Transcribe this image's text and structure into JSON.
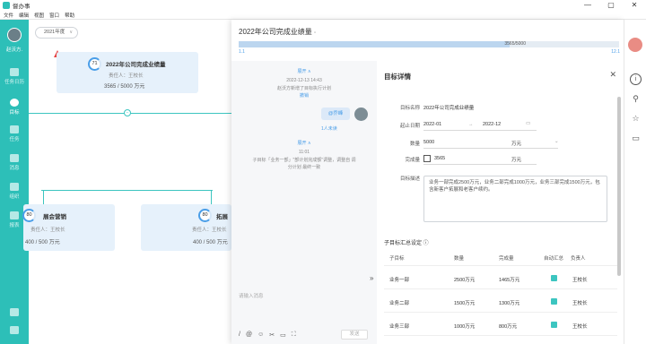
{
  "window": {
    "app_name": "督办事",
    "menu": [
      "文件",
      "编辑",
      "视图",
      "窗口",
      "帮助"
    ],
    "controls": [
      "—",
      "▢",
      "✕"
    ]
  },
  "leftnav": {
    "user_name": "赵沃方.",
    "items": [
      {
        "label": "任务日历",
        "icon": "calendar-icon"
      },
      {
        "label": "目标",
        "icon": "target-icon"
      },
      {
        "label": "任务",
        "icon": "task-icon"
      },
      {
        "label": "消息",
        "icon": "message-icon"
      },
      {
        "label": "组织",
        "icon": "org-icon"
      },
      {
        "label": "报表",
        "icon": "chart-icon"
      }
    ],
    "bottom_icons": [
      "team-icon",
      "file-icon"
    ],
    "active_index": 1
  },
  "canvas": {
    "year_select": "2021年度",
    "root_goal": {
      "progress": "71",
      "title": "2022年公司完成业绩量",
      "owner": "责任人：王校长",
      "value": "3565 / 5000 万元"
    },
    "child_goals": [
      {
        "progress": "80",
        "title": "展会营销",
        "owner": "责任人：王校长",
        "value": "400 / 500 万元"
      },
      {
        "progress": "80",
        "title": "拓展",
        "owner": "责任人：王校长",
        "value": "400 / 500 万元"
      }
    ]
  },
  "panel": {
    "title": "2022年公司完成业绩量",
    "progress_text": "3565/5000",
    "progress_fraction": 0.713,
    "start_label": "1.1",
    "end_label": "12.1",
    "chat": {
      "expand_label_1": "展开 ∧",
      "time_1": "2022-12-13 14:43",
      "system_msg_1": "赵沃方新增了目标执行计划",
      "link_1": "撤销",
      "bubble_text": "@乔峰",
      "read_label": "1人未读",
      "expand_label_2": "展开 ∧",
      "time_2": "11:01",
      "system_msg_2a": "子目标「业务一部」\"部计划完成额\"调整，调整自 调",
      "system_msg_2b": "分计划 最终一致",
      "input_placeholder": "请输入消息",
      "tools": [
        "/",
        "@",
        "☺",
        "✂",
        "▭",
        "⛶"
      ],
      "send_label": "发送",
      "collapse_icon": "»"
    },
    "detail": {
      "title": "目标详情",
      "fields": {
        "name_label": "目标名称",
        "name_value": "2022年公司完成业绩量",
        "date_label": "起止日期",
        "date_start": "2022-01",
        "date_arrow": "→",
        "date_end": "2022-12",
        "qty_label": "数量",
        "qty_value": "5000",
        "qty_unit": "万元",
        "done_label": "完成量",
        "done_value": "3565",
        "done_unit": "万元",
        "desc_label": "目标描述",
        "desc_value": "业务一部完成2500万元，业务二部完成1000万元，业务三部完成1500万元，包含新客户拓展和老客户续约。"
      },
      "sub_heading": "子目标汇总设定 ⓘ",
      "table": {
        "headers": [
          "子目标",
          "数量",
          "完成量",
          "自动汇总",
          "负责人"
        ],
        "rows": [
          [
            "业务一部",
            "2500万元",
            "1465万元",
            true,
            "王校长"
          ],
          [
            "业务二部",
            "1500万元",
            "1300万元",
            true,
            "王校长"
          ],
          [
            "业务三部",
            "1000万元",
            "800万元",
            true,
            "王校长"
          ]
        ]
      }
    }
  },
  "rightstrip": {
    "icons": [
      "info-icon",
      "user-icon",
      "star-icon",
      "folder-icon"
    ]
  },
  "colors": {
    "accent": "#2dbfb8",
    "primary": "#4a9ee8"
  }
}
